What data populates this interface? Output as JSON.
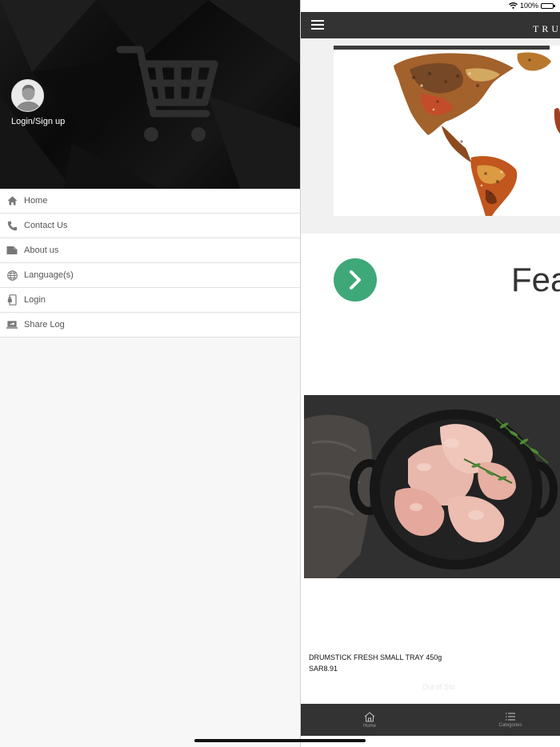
{
  "status_bar": {
    "battery_text": "100%"
  },
  "app": {
    "brand": "TRU",
    "featured_title": "Fea",
    "product": {
      "name": "DRUMSTICK FRESH SMALL TRAY 450g",
      "price": "SAR8.91",
      "stock_status": "Out of Sto"
    },
    "bottom_nav": [
      {
        "label": "Home",
        "icon": "home-icon"
      },
      {
        "label": "Categories",
        "icon": "list-icon"
      }
    ]
  },
  "drawer": {
    "login_label": "Login/Sign up",
    "menu": [
      {
        "label": "Home",
        "icon": "home-icon"
      },
      {
        "label": "Contact Us",
        "icon": "phone-icon"
      },
      {
        "label": "About us",
        "icon": "folder-icon"
      },
      {
        "label": "Language(s)",
        "icon": "globe-icon"
      },
      {
        "label": "Login",
        "icon": "login-icon"
      },
      {
        "label": "Share Log",
        "icon": "share-icon"
      }
    ]
  },
  "colors": {
    "topbar": "#333333",
    "accent_green": "#3fa878",
    "drawer_header": "#0d0d0d"
  }
}
